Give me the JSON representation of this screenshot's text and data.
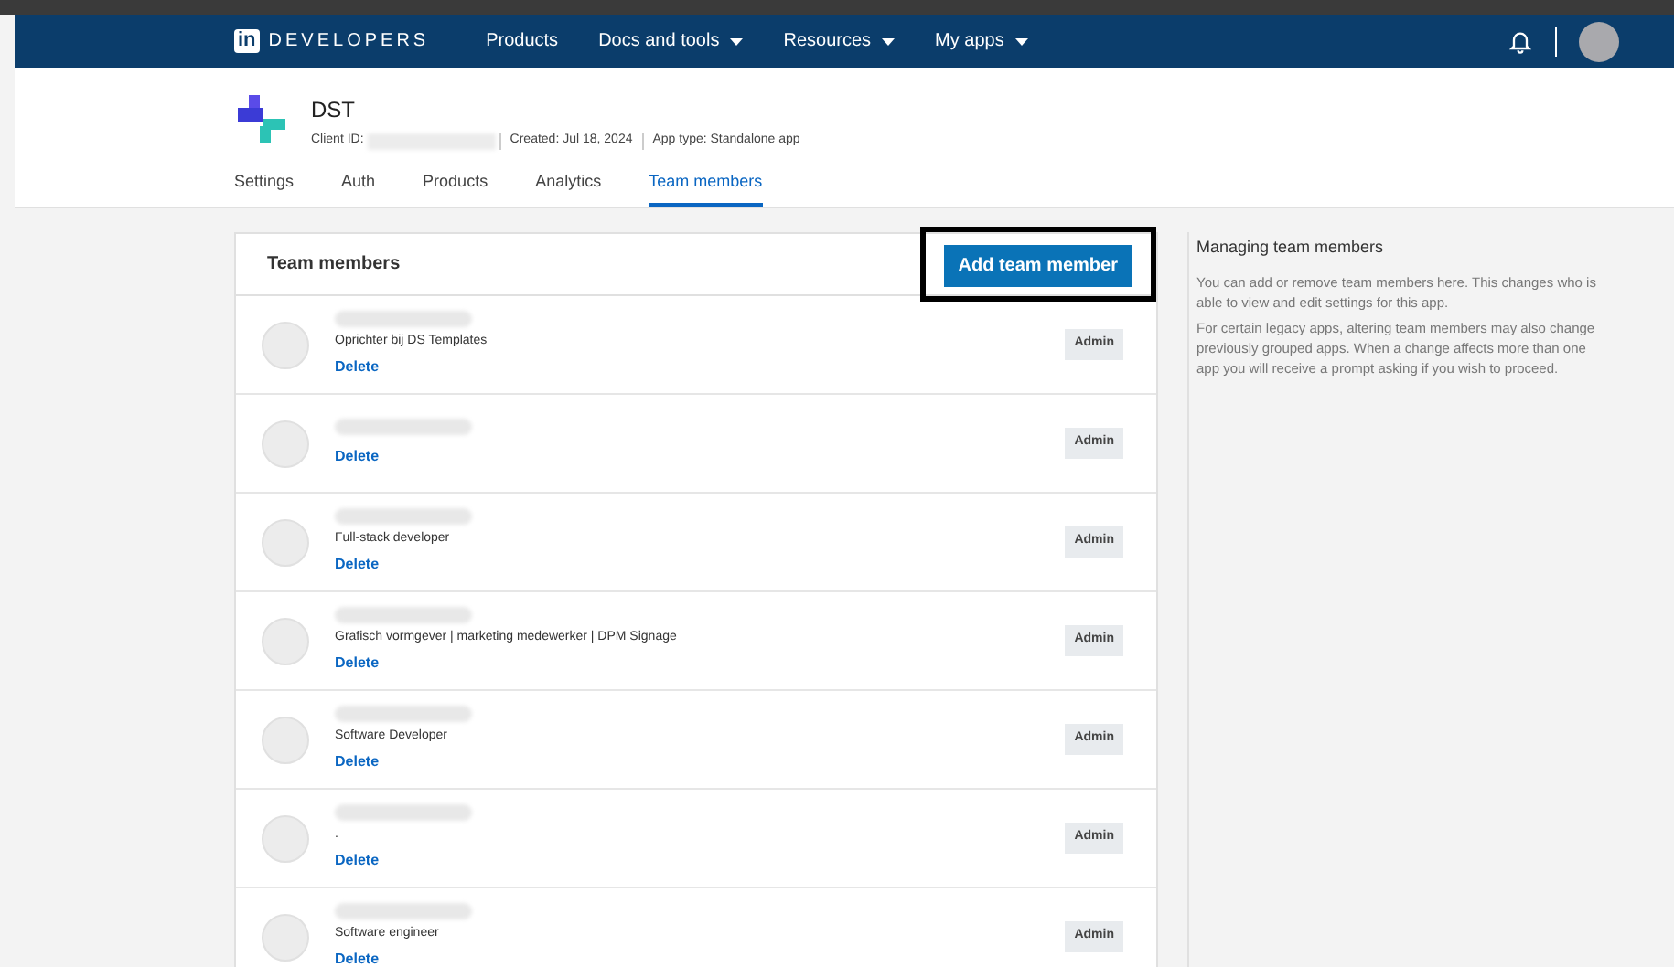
{
  "nav": {
    "brand_badge": "in",
    "brand": "DEVELOPERS",
    "items": [
      {
        "label": "Products",
        "dropdown": false
      },
      {
        "label": "Docs and tools",
        "dropdown": true
      },
      {
        "label": "Resources",
        "dropdown": true
      },
      {
        "label": "My apps",
        "dropdown": true
      }
    ]
  },
  "app": {
    "name": "DST",
    "client_id_label": "Client ID:",
    "created": "Created: Jul 18, 2024",
    "app_type": "App type: Standalone app"
  },
  "tabs": [
    {
      "label": "Settings",
      "selected": false
    },
    {
      "label": "Auth",
      "selected": false
    },
    {
      "label": "Products",
      "selected": false
    },
    {
      "label": "Analytics",
      "selected": false
    },
    {
      "label": "Team members",
      "selected": true
    }
  ],
  "card": {
    "title": "Team members",
    "add_button": "Add team member",
    "members": [
      {
        "role": "Oprichter bij DS Templates",
        "delete": "Delete",
        "badge": "Admin"
      },
      {
        "delete": "Delete",
        "badge": "Admin"
      },
      {
        "role": "Full-stack developer",
        "delete": "Delete",
        "badge": "Admin"
      },
      {
        "role": "Grafisch vormgever | marketing medewerker | DPM Signage",
        "delete": "Delete",
        "badge": "Admin"
      },
      {
        "role": "Software Developer",
        "delete": "Delete",
        "badge": "Admin"
      },
      {
        "role": ".",
        "delete": "Delete",
        "badge": "Admin"
      },
      {
        "role": "Software engineer",
        "delete": "Delete",
        "badge": "Admin"
      }
    ]
  },
  "side": {
    "title": "Managing team members",
    "paragraphs": [
      "You can add or remove team members here. This changes who is able to view and edit settings for this app.",
      "For certain legacy apps, altering team members may also change previously grouped apps. When a change affects more than one app you will receive a prompt asking if you wish to proceed."
    ]
  }
}
